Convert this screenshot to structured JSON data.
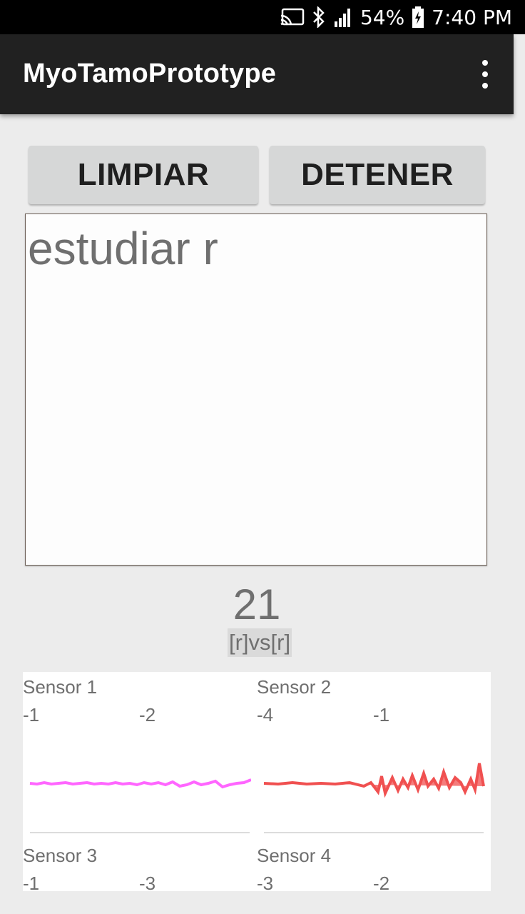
{
  "status_bar": {
    "battery": "54%",
    "time": "7:40 PM",
    "icons": [
      "cast-icon",
      "bluetooth-icon",
      "signal-icon",
      "battery-charging-icon"
    ]
  },
  "app_bar": {
    "title": "MyoTamoPrototype",
    "menu_icon": "overflow-menu-icon"
  },
  "buttons": {
    "clear": "LIMPIAR",
    "stop": "DETENER"
  },
  "text_area": {
    "value": "estudiar r"
  },
  "counter": "21",
  "comparison": "[r]vs[r]",
  "sensors": [
    {
      "title": "Sensor 1",
      "value_a": "-1",
      "value_b": "-2",
      "color": "#ff55ff"
    },
    {
      "title": "Sensor 2",
      "value_a": "-4",
      "value_b": "-1",
      "color": "#f05050"
    },
    {
      "title": "Sensor 3",
      "value_a": "-1",
      "value_b": "-3",
      "color": "#ff55ff"
    },
    {
      "title": "Sensor 4",
      "value_a": "-3",
      "value_b": "-2",
      "color": "#f05050"
    }
  ],
  "colors": {
    "app_bar": "#212121",
    "background": "#ececec",
    "button": "#d6d7d7",
    "text_gray": "#6f6f6f"
  }
}
